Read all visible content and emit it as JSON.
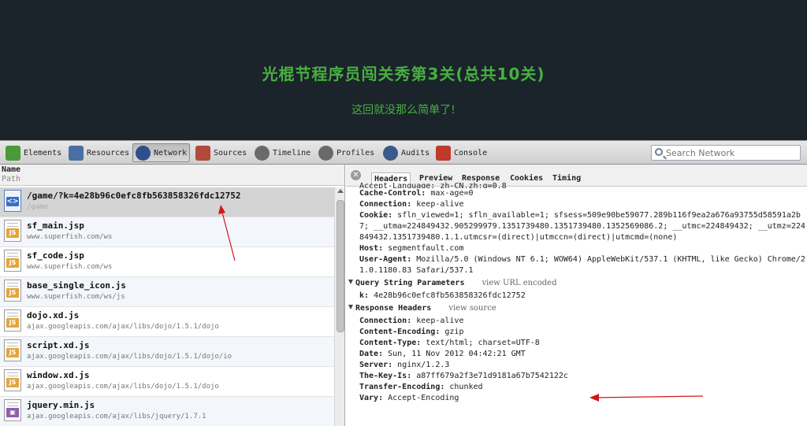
{
  "page": {
    "title": "光棍节程序员闯关秀第3关(总共10关)",
    "subtitle": "这回就没那么简单了!"
  },
  "toolbar": {
    "tabs": [
      {
        "label": "Elements",
        "icon": "elements-icon",
        "color": "#4a9a3a"
      },
      {
        "label": "Resources",
        "icon": "resources-icon",
        "color": "#4a6fa5"
      },
      {
        "label": "Network",
        "icon": "network-icon",
        "color": "#2f4f8a"
      },
      {
        "label": "Sources",
        "icon": "sources-icon",
        "color": "#b04a3a"
      },
      {
        "label": "Timeline",
        "icon": "timeline-icon",
        "color": "#6a6a6a"
      },
      {
        "label": "Profiles",
        "icon": "profiles-icon",
        "color": "#6a6a6a"
      },
      {
        "label": "Audits",
        "icon": "audits-icon",
        "color": "#3a5a8a"
      },
      {
        "label": "Console",
        "icon": "console-icon",
        "color": "#c0392b"
      }
    ],
    "active_tab": "Network",
    "search_placeholder": "Search Network"
  },
  "network_list": {
    "col_name": "Name",
    "col_path": "Path",
    "rows": [
      {
        "name": "/game/?k=4e28b96c0efc8fb563858326fdc12752",
        "path": "/game",
        "type": "doc"
      },
      {
        "name": "sf_main.jsp",
        "path": "www.superfish.com/ws",
        "type": "js"
      },
      {
        "name": "sf_code.jsp",
        "path": "www.superfish.com/ws",
        "type": "js"
      },
      {
        "name": "base_single_icon.js",
        "path": "www.superfish.com/ws/js",
        "type": "js"
      },
      {
        "name": "dojo.xd.js",
        "path": "ajax.googleapis.com/ajax/libs/dojo/1.5.1/dojo",
        "type": "js"
      },
      {
        "name": "script.xd.js",
        "path": "ajax.googleapis.com/ajax/libs/dojo/1.5.1/dojo/io",
        "type": "js"
      },
      {
        "name": "window.xd.js",
        "path": "ajax.googleapis.com/ajax/libs/dojo/1.5.1/dojo",
        "type": "js"
      },
      {
        "name": "jquery.min.js",
        "path": "ajax.googleapis.com/ajax/libs/jquery/1.7.1",
        "type": "img"
      }
    ]
  },
  "detail": {
    "tabs": [
      "Headers",
      "Preview",
      "Response",
      "Cookies",
      "Timing"
    ],
    "active_tab": "Headers",
    "partial_line": "Accept-Language: zh-CN,zh;q=0.8",
    "request_headers": [
      {
        "key": "Cache-Control:",
        "value": " max-age=0"
      },
      {
        "key": "Connection:",
        "value": " keep-alive"
      },
      {
        "key": "Cookie:",
        "value": " sfln_viewed=1; sfln_available=1; sfsess=509e90be59077.289b116f9ea2a676a93755d58591a2b7; __utma=224849432.905299979.1351739480.1351739480.1352569086.2; __utmc=224849432; __utmz=224849432.1351739480.1.1.utmcsr=(direct)|utmccn=(direct)|utmcmd=(none)"
      },
      {
        "key": "Host:",
        "value": " segmentfault.com"
      },
      {
        "key": "User-Agent:",
        "value": " Mozilla/5.0 (Windows NT 6.1; WOW64) AppleWebKit/537.1 (KHTML, like Gecko) Chrome/21.0.1180.83 Safari/537.1"
      }
    ],
    "query_section": {
      "title": "Query String Parameters",
      "extra": "view URL encoded"
    },
    "query_params": [
      {
        "key": "k:",
        "value": " 4e28b96c0efc8fb563858326fdc12752"
      }
    ],
    "response_section": {
      "title": "Response Headers",
      "extra": "view source"
    },
    "response_headers": [
      {
        "key": "Connection:",
        "value": " keep-alive"
      },
      {
        "key": "Content-Encoding:",
        "value": " gzip"
      },
      {
        "key": "Content-Type:",
        "value": " text/html; charset=UTF-8"
      },
      {
        "key": "Date:",
        "value": " Sun, 11 Nov 2012 04:42:21 GMT"
      },
      {
        "key": "Server:",
        "value": " nginx/1.2.3"
      },
      {
        "key": "The-Key-Is:",
        "value": " a87ff679a2f3e71d9181a67b7542122c"
      },
      {
        "key": "Transfer-Encoding:",
        "value": " chunked"
      },
      {
        "key": "Vary:",
        "value": " Accept-Encoding"
      }
    ]
  },
  "annotations": {
    "arrow_color": "#d01818"
  }
}
